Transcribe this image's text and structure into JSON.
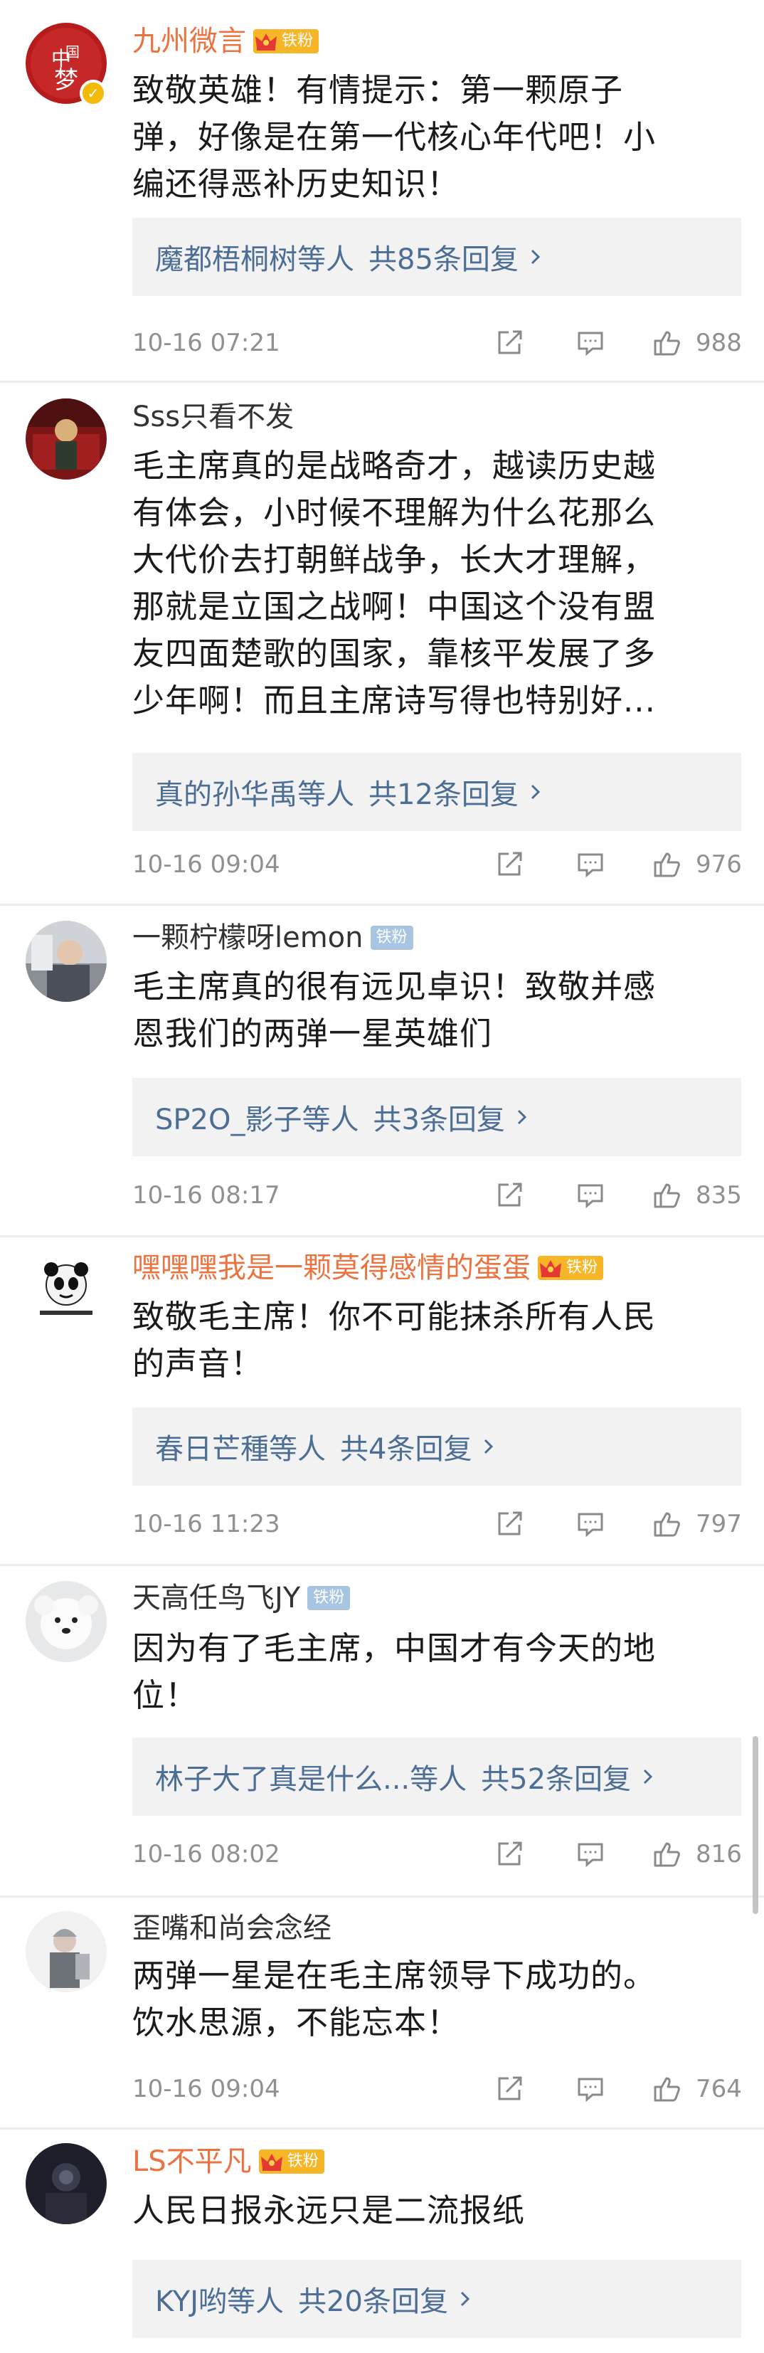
{
  "actions": {
    "share_icon": "share-icon",
    "reply_icon": "comment-icon",
    "like_icon": "like-icon"
  },
  "colors": {
    "vip_name": "#eb7340",
    "link": "#4c6e94",
    "fan_badge_gold": "#f6b628",
    "fan_badge_plain": "#a7c4e0"
  },
  "comments": [
    {
      "username": "九州微言",
      "name_style": "vip",
      "badge": "铁粉",
      "badge_style": "gold",
      "verified": true,
      "avatar": "china-dream-avatar",
      "content": [
        "致敬英雄！有情提示：第一颗原子",
        "弹，好像是在第一代核心年代吧！小",
        "编还得恶补历史知识！"
      ],
      "reply": {
        "users": "魔都梧桐树",
        "deng": "等人",
        "count": "共85条回复"
      },
      "timestamp": "10-16 07:21",
      "likes": "988"
    },
    {
      "username": "Sss只看不发",
      "name_style": "normal",
      "badge": "",
      "badge_style": "none",
      "verified": false,
      "avatar": "red-portrait-avatar",
      "content": [
        "毛主席真的是战略奇才，越读历史越",
        "有体会，小时候不理解为什么花那么",
        "大代价去打朝鲜战争，长大才理解，",
        "那就是立国之战啊！中国这个没有盟",
        "友四面楚歌的国家，靠核平发展了多",
        "少年啊！而且主席诗写得也特别好..."
      ],
      "reply": {
        "users": "真的孙华禹",
        "deng": "等人",
        "count": "共12条回复"
      },
      "timestamp": "10-16 09:04",
      "likes": "976"
    },
    {
      "username": "一颗柠檬呀lemon",
      "name_style": "normal",
      "badge": "铁粉",
      "badge_style": "plain",
      "verified": false,
      "avatar": "person-photo-avatar",
      "content": [
        "毛主席真的很有远见卓识！致敬并感",
        "恩我们的两弹一星英雄们"
      ],
      "reply": {
        "users": "SP2O_影子",
        "deng": "等人",
        "count": "共3条回复"
      },
      "timestamp": "10-16 08:17",
      "likes": "835"
    },
    {
      "username": "嘿嘿嘿我是一颗莫得感情的蛋蛋",
      "name_style": "vip",
      "badge": "铁粉",
      "badge_style": "gold",
      "verified": false,
      "avatar": "panda-meme-avatar",
      "content": [
        "致敬毛主席！你不可能抹杀所有人民",
        "的声音！"
      ],
      "reply": {
        "users": "春日芒種",
        "deng": "等人",
        "count": "共4条回复"
      },
      "timestamp": "10-16 11:23",
      "likes": "797"
    },
    {
      "username": "天高任鸟飞JY",
      "name_style": "normal",
      "badge": "铁粉",
      "badge_style": "plain",
      "verified": false,
      "avatar": "white-dog-avatar",
      "content": [
        "因为有了毛主席，中国才有今天的地",
        "位！"
      ],
      "reply": {
        "users": "林子大了真是什么...",
        "deng": "等人",
        "count": "共52条回复"
      },
      "timestamp": "10-16 08:02",
      "likes": "816"
    },
    {
      "username": "歪嘴和尚会念经",
      "name_style": "normal",
      "badge": "",
      "badge_style": "none",
      "verified": false,
      "avatar": "grey-figure-avatar",
      "content": [
        "两弹一星是在毛主席领导下成功的。",
        "饮水思源，不能忘本！"
      ],
      "reply": null,
      "timestamp": "10-16 09:04",
      "likes": "764"
    },
    {
      "username": "LS不平凡",
      "name_style": "vip",
      "badge": "铁粉",
      "badge_style": "gold",
      "verified": false,
      "avatar": "dark-portrait-avatar",
      "content": [
        "人民日报永远只是二流报纸"
      ],
      "reply": {
        "users": "KYJ哟",
        "deng": "等人",
        "count": "共20条回复"
      },
      "timestamp": "",
      "likes": ""
    }
  ]
}
